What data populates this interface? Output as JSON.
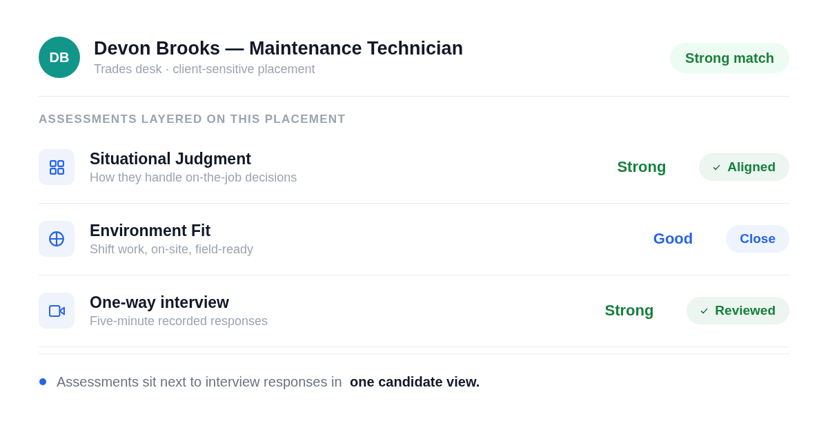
{
  "header": {
    "avatar": {
      "initials": "DB"
    },
    "title": "Devon Brooks — Maintenance Technician",
    "subtitle": "Trades desk · client-sensitive placement",
    "badge": "Strong match"
  },
  "section": {
    "label": "ASSESSMENTS LAYERED ON THIS PLACEMENT"
  },
  "assessments": [
    {
      "kind": "judgment",
      "title": "Situational Judgment",
      "subtitle": "How they handle on-the-job decisions",
      "rating": "Strong",
      "color": "#15803d",
      "status": {
        "label": "Aligned",
        "ticked": true
      }
    },
    {
      "kind": "environment",
      "title": "Environment Fit",
      "subtitle": "Shift work, on-site, field-ready",
      "rating": "Good",
      "color": "#2563eb",
      "status": {
        "label": "Close",
        "ticked": false
      }
    },
    {
      "kind": "interview",
      "title": "One-way interview",
      "subtitle": "Five-minute recorded responses",
      "rating": "Strong",
      "color": "#15803d",
      "status": {
        "label": "Reviewed",
        "ticked": true
      }
    }
  ],
  "footer": {
    "text": "Assessments sit next to interview responses in **one candidate view.**"
  }
}
